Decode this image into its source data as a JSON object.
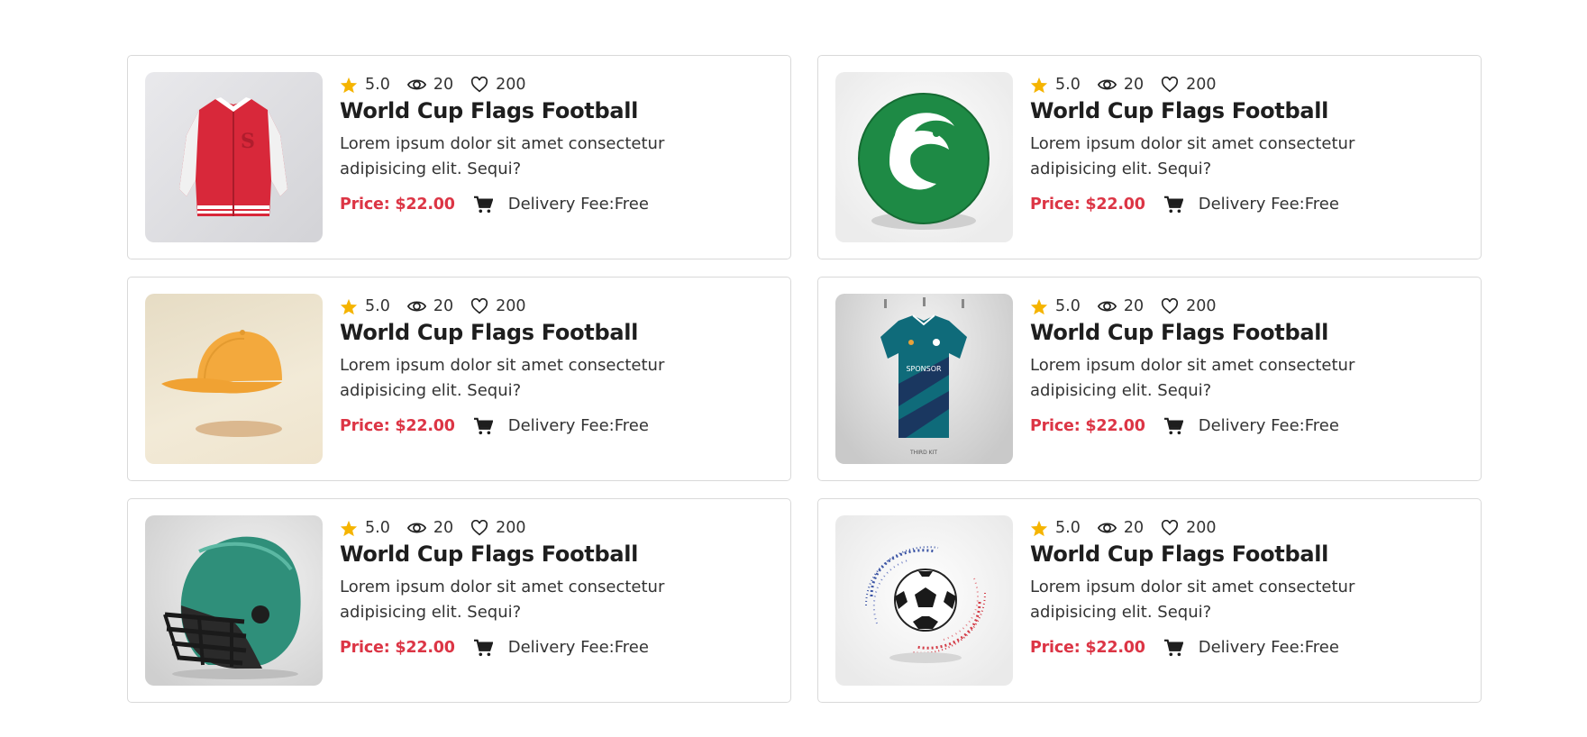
{
  "products": [
    {
      "rating": "5.0",
      "views": "20",
      "likes": "200",
      "title": "World Cup Flags Football",
      "description": "Lorem ipsum dolor sit amet consectetur adipisicing elit. Sequi?",
      "price": "Price: $22.00",
      "delivery": "Delivery Fee:Free",
      "image": "red varsity jacket"
    },
    {
      "rating": "5.0",
      "views": "20",
      "likes": "200",
      "title": "World Cup Flags Football",
      "description": "Lorem ipsum dolor sit amet consectetur adipisicing elit. Sequi?",
      "price": "Price: $22.00",
      "delivery": "Delivery Fee:Free",
      "image": "green football with eagle logo"
    },
    {
      "rating": "5.0",
      "views": "20",
      "likes": "200",
      "title": "World Cup Flags Football",
      "description": "Lorem ipsum dolor sit amet consectetur adipisicing elit. Sequi?",
      "price": "Price: $22.00",
      "delivery": "Delivery Fee:Free",
      "image": "orange baseball cap"
    },
    {
      "rating": "5.0",
      "views": "20",
      "likes": "200",
      "title": "World Cup Flags Football",
      "description": "Lorem ipsum dolor sit amet consectetur adipisicing elit. Sequi?",
      "price": "Price: $22.00",
      "delivery": "Delivery Fee:Free",
      "image": "teal sports jersey"
    },
    {
      "rating": "5.0",
      "views": "20",
      "likes": "200",
      "title": "World Cup Flags Football",
      "description": "Lorem ipsum dolor sit amet consectetur adipisicing elit. Sequi?",
      "price": "Price: $22.00",
      "delivery": "Delivery Fee:Free",
      "image": "green football helmet"
    },
    {
      "rating": "5.0",
      "views": "20",
      "likes": "200",
      "title": "World Cup Flags Football",
      "description": "Lorem ipsum dolor sit amet consectetur adipisicing elit. Sequi?",
      "price": "Price: $22.00",
      "delivery": "Delivery Fee:Free",
      "image": "soccer ball with flag swirl"
    }
  ],
  "jersey_text": {
    "sponsor": "SPONSOR",
    "kit": "THIRD KIT"
  },
  "icons": {
    "star": "star-icon",
    "views": "eye-icon",
    "likes": "heart-icon",
    "cart": "cart-icon"
  },
  "colors": {
    "star": "#f5b400",
    "price": "#dc3545",
    "border": "#d9d9d9"
  }
}
